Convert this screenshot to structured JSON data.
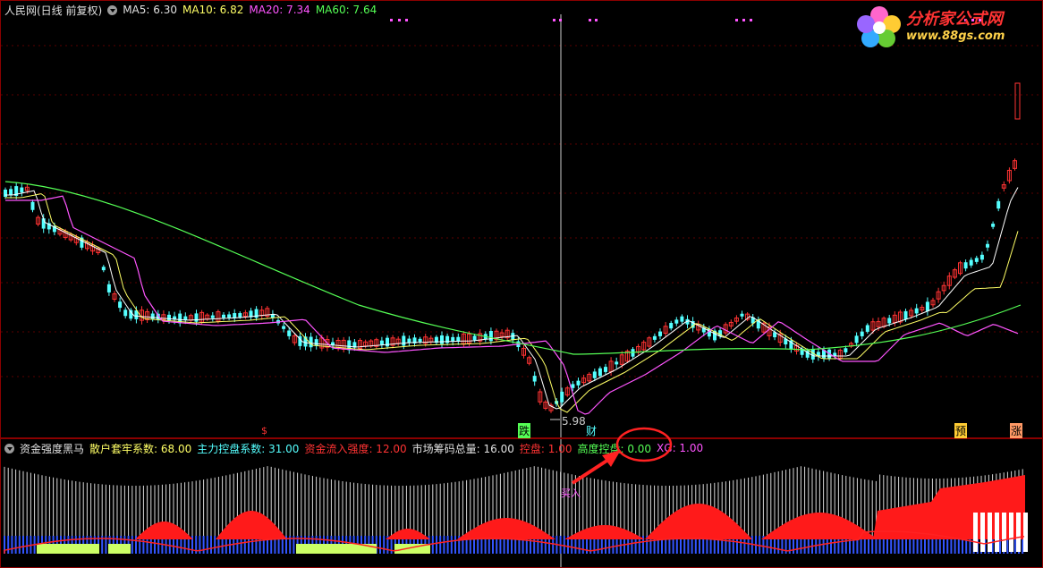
{
  "price_header": {
    "title": "人民网(日线 前复权)",
    "ma5": "MA5: 6.30",
    "ma10": "MA10: 6.82",
    "ma20": "MA20: 7.34",
    "ma60": "MA60: 7.64"
  },
  "indicator_header": {
    "title": "资金强度黑马",
    "retail": "散户套牢系数: 68.00",
    "main_ctrl": "主力控盘系数: 31.00",
    "inflow": "资金流入强度: 12.00",
    "chips": "市场筹码总量: 16.00",
    "ctrl": "控盘: 1.00",
    "high_ctrl": "高度控盘: 0.00",
    "xg": "XG: 1.00"
  },
  "logo": {
    "name": "分析家公式网",
    "url": "www.88gs.com"
  },
  "annotations": {
    "low_price": "5.98",
    "marker_s": "$",
    "marker_die": "跌",
    "marker_cai": "财",
    "marker_yu": "预",
    "marker_zhang": "涨",
    "buy_label": "买入"
  },
  "colors": {
    "ma5": "#ffffff",
    "ma10": "#ffff66",
    "ma20": "#ff55ff",
    "ma60": "#55ff55",
    "up": "#ff3333",
    "down": "#55ffff",
    "border": "#8b0000",
    "accent_circle": "#ff2222"
  },
  "icons": [
    "panel-menu-icon",
    "logo-flower-icon",
    "arrow-icon"
  ]
}
